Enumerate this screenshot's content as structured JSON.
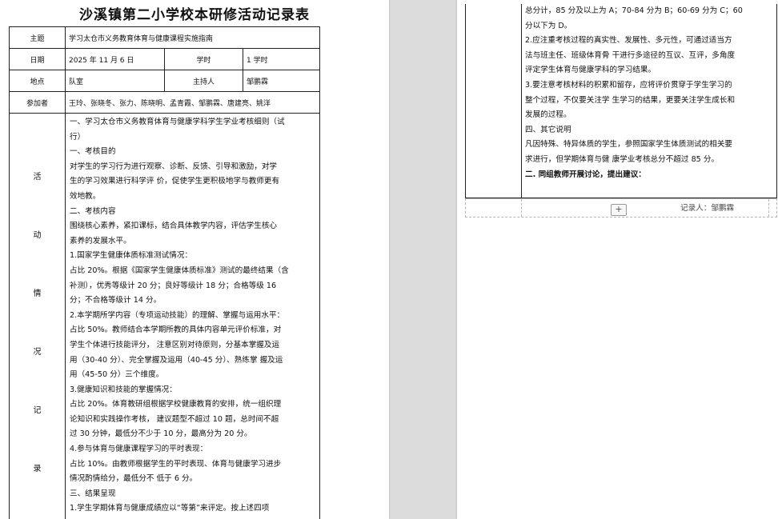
{
  "left_page": {
    "title": "沙溪镇第二小学校本研修活动记录表",
    "rows": {
      "topic_label": "主题",
      "topic_value": "学习太仓市义务教育体育与健康课程实施指南",
      "date_label": "日期",
      "date_value": "2025 年 11 月 6 日",
      "hours_label": "学时",
      "hours_value": "1 学时",
      "place_label": "地点",
      "place_value": "队室",
      "host_label": "主持人",
      "host_value": "邹鹏霖",
      "participants_label": "参加者",
      "participants_value": "王玲、张晓冬、张力、陈晓明、孟青霞、邹鹏霖、唐建亮、姚洋"
    },
    "activity_label_chars": [
      "活",
      "动",
      "情",
      "况",
      "记",
      "录"
    ],
    "content_lines": [
      "一、学习太仓市义务教育体育与健康学科学生学业考核细则（试",
      "行）",
      "一、考核目的",
      "对学生的学习行为进行观察、诊断、反馈、引导和激励，对学",
      "生的学习效果进行科学评 价，促使学生更积极地学与教师更有",
      "效地教。",
      "二、考核内容",
      "围绕核心素养，紧扣课标，结合具体教学内容，评估学生核心",
      "素养的发展水平。",
      "1.国家学生健康体质标准测试情况：",
      "占比 20%。根据《国家学生健康体质标准》测试的最终结果（含",
      "补测），优秀等级计 20 分；良好等级计 18 分；合格等级 16",
      "分；不合格等级计 14 分。",
      "2.本学期所学内容（专项运动技能）的理解、掌握与运用水平：",
      "占比 50%。教师结合本学期所教的具体内容单元评价标准，对",
      "学生个体进行技能评分， 注意区别对待原则，分基本掌握及运",
      "用（30-40 分）、完全掌握及运用（40-45 分）、熟练掌 握及运",
      "用（45-50 分）三个维度。",
      "3.健康知识和技能的掌握情况：",
      "占比 20%。体育教研组根据学校健康教育的安排，统一组织理",
      "论知识和实践操作考核， 建议题型不超过 10 题，总时间不超",
      "过 30 分钟，最低分不少于 10 分，最高分为 20 分。",
      "4.参与体育与健康课程学习的平时表现：",
      "占比 10%。由教师根据学生的平时表现、体育与健康学习进步",
      "情况酌情给分，最低分不 低于 6 分。",
      "三、结果呈现",
      "1.学生学期体育与健康成绩应以“等第”来评定。按上述四项"
    ]
  },
  "right_page": {
    "content_lines": [
      "总分计，85 分及以上为 A；70-84 分为 B；60-69 分为 C；60",
      "分以下为 D。",
      "2.应注重考核过程的真实性、发展性、多元性，可通过适当方",
      "法与班主任、班级体育骨 干进行多途径的互议、互评，多角度",
      "评定学生体育与健康学科的学习结果。",
      "3.要注意考核材料的积累和留存，应将评价贯穿于学生学习的",
      "整个过程，不仅要关注学 生学习的结果，更要关注学生成长和",
      "发展的过程。",
      "四、其它说明",
      "凡因特殊、特异体质的学生，参照国家学生体质测试的相关要",
      "求进行，但学期体育与健 康学业考核总分不超过 85 分。"
    ],
    "discussion_heading": "二. 同组教师开展讨论，提出建议：",
    "add_button_label": "+",
    "recorder": "记录人：邹鹏霖"
  }
}
